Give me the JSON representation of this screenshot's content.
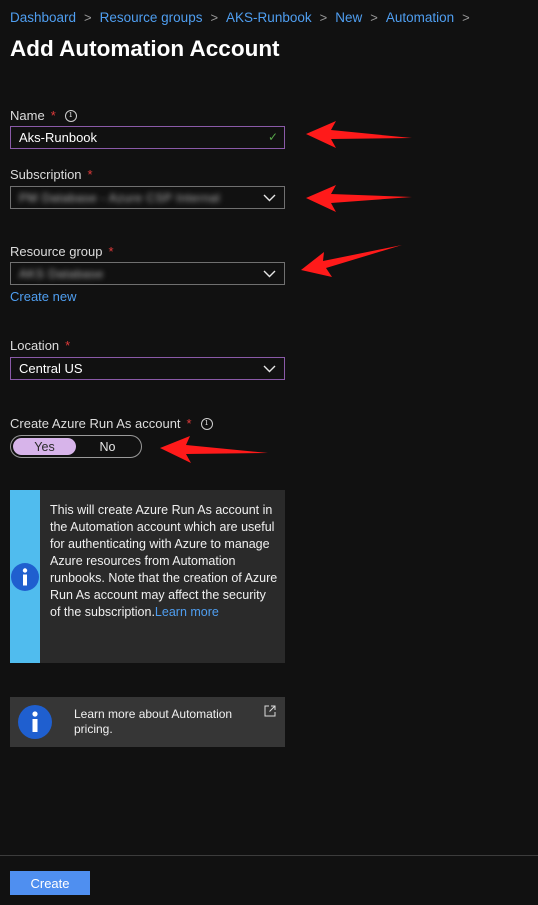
{
  "breadcrumb": [
    "Dashboard",
    "Resource groups",
    "AKS-Runbook",
    "New",
    "Automation"
  ],
  "page_title": "Add Automation Account",
  "form": {
    "name": {
      "label": "Name",
      "value": "Aks-Runbook"
    },
    "subscription": {
      "label": "Subscription",
      "value": "PM Database - Azure CSP Internal"
    },
    "resource_group": {
      "label": "Resource group",
      "value": "AKS Database",
      "create_new": "Create new"
    },
    "location": {
      "label": "Location",
      "value": "Central US"
    },
    "run_as": {
      "label": "Create Azure Run As account",
      "yes": "Yes",
      "no": "No",
      "selected": "Yes"
    }
  },
  "info_box": {
    "text": "This will create Azure Run As account in the Automation account which are useful for authenticating with Azure to manage Azure resources from Automation runbooks. Note that the creation of Azure Run As account may affect the security of the subscription.",
    "link": "Learn more"
  },
  "pricing_box": {
    "text": "Learn more about Automation pricing."
  },
  "footer": {
    "create_label": "Create"
  },
  "colors": {
    "accent": "#4f9ef0",
    "required": "#e23a3a",
    "toggle_selected": "#d7b4ea",
    "info_stripe": "#50bcee",
    "annotation_arrow": "#ff1a1a"
  },
  "icons": {
    "info": "info-circle-icon",
    "chevron": "chevron-down-icon",
    "check": "checkmark-icon",
    "external": "external-link-icon"
  }
}
